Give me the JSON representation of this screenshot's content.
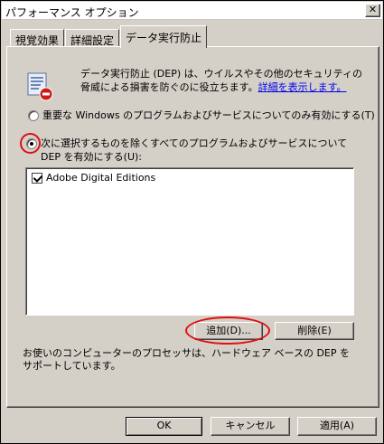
{
  "window": {
    "title": "パフォーマンス オプション",
    "close_label": "✕"
  },
  "tabs": [
    {
      "label": "視覚効果",
      "active": false
    },
    {
      "label": "詳細設定",
      "active": false
    },
    {
      "label": "データ実行防止",
      "active": true
    }
  ],
  "description": {
    "text": "データ実行防止 (DEP) は、ウイルスやその他のセキュリティの脅威による損害を防ぐのに役立ちます。",
    "link": "詳細を表示します。"
  },
  "options": [
    {
      "label": "重要な Windows のプログラムおよびサービスについてのみ有効にする(T)",
      "selected": false
    },
    {
      "label": "次に選択するものを除くすべてのプログラムおよびサービスについて DEP を有効にする(U):",
      "selected": true
    }
  ],
  "program_list": [
    {
      "label": "Adobe Digital Editions",
      "checked": true
    }
  ],
  "list_buttons": {
    "add": "追加(D)...",
    "remove": "削除(E)"
  },
  "support_text": "お使いのコンピューターのプロセッサは、ハードウェア ベースの DEP をサポートしています。",
  "footer": {
    "ok": "OK",
    "cancel": "キャンセル",
    "apply": "適用(A)"
  },
  "colors": {
    "annotation": "#e01010",
    "link": "#0000ee",
    "face": "#d4d0c8"
  }
}
